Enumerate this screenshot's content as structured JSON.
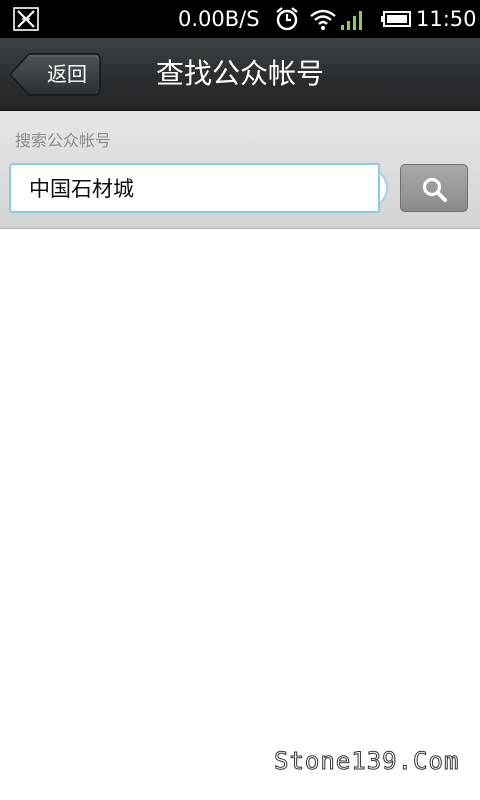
{
  "status_bar": {
    "net_speed": "0.00B/S",
    "time": "11:50",
    "icons": [
      "app-notification-icon",
      "alarm-icon",
      "wifi-icon",
      "signal-icon",
      "battery-icon"
    ],
    "signal_color": "#8fd13b"
  },
  "title_bar": {
    "back_label": "返回",
    "title": "查找公众帐号"
  },
  "search": {
    "label": "搜索公众帐号",
    "input_value": "中国石材城",
    "focus_border_color": "#8ccbe6",
    "button_icon": "search-icon"
  },
  "watermark": "Stone139.Com"
}
